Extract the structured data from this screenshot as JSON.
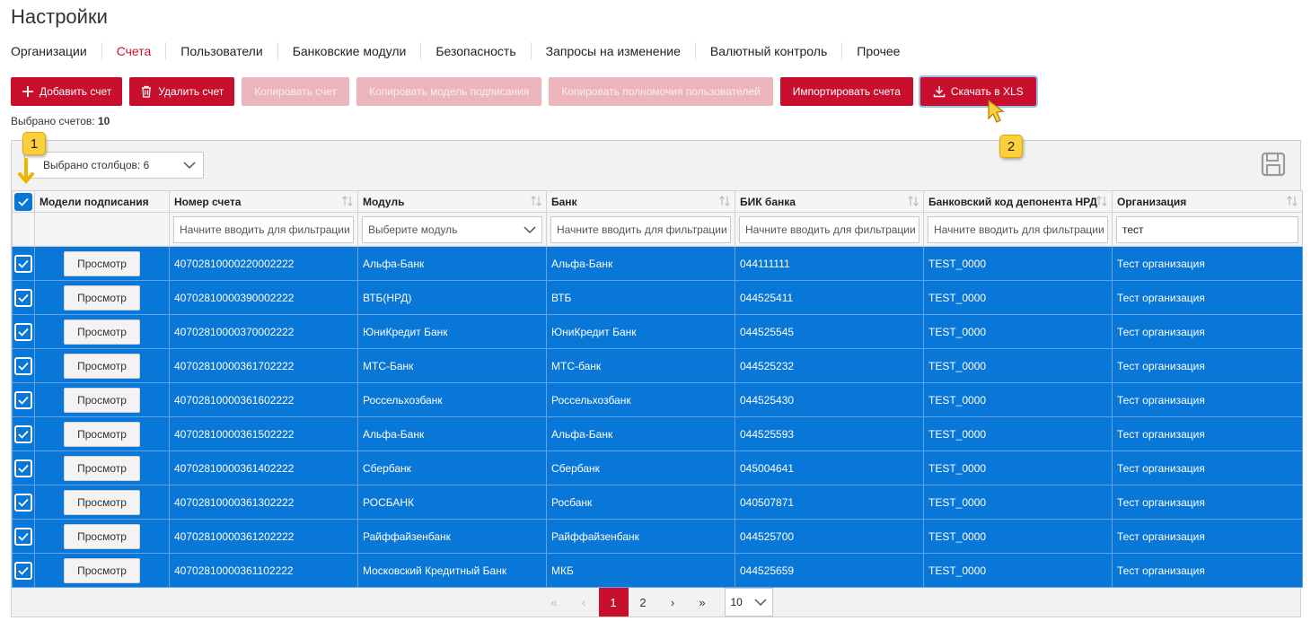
{
  "page": {
    "title": "Настройки"
  },
  "tabs": [
    {
      "label": "Организации",
      "active": false
    },
    {
      "label": "Счета",
      "active": true
    },
    {
      "label": "Пользователи",
      "active": false
    },
    {
      "label": "Банковские модули",
      "active": false
    },
    {
      "label": "Безопасность",
      "active": false
    },
    {
      "label": "Запросы на изменение",
      "active": false
    },
    {
      "label": "Валютный контроль",
      "active": false
    },
    {
      "label": "Прочее",
      "active": false
    }
  ],
  "toolbar": {
    "add_account": "Добавить счет",
    "delete_account": "Удалить счет",
    "copy_account": "Копировать счет",
    "copy_signing_model": "Копировать модель подписания",
    "copy_user_permissions": "Копировать полномочия пользователей",
    "import_accounts": "Импортировать счета",
    "download_xls": "Скачать в XLS"
  },
  "selection": {
    "label": "Выбрано счетов:",
    "count": "10"
  },
  "columns_selector": {
    "label": "Выбрано столбцов: 6"
  },
  "columns": {
    "signing_models": "Модели подписания",
    "account_number": "Номер счета",
    "module": "Модуль",
    "bank": "Банк",
    "bik": "БИК банка",
    "depositary_code": "Банковский код депонента НРД",
    "organization": "Организация"
  },
  "filters": {
    "account_number_placeholder": "Начните вводить для фильтрации",
    "module_placeholder": "Выберите модуль",
    "bank_placeholder": "Начните вводить для фильтрации",
    "bik_placeholder": "Начните вводить для фильтрации",
    "depositary_placeholder": "Начните вводить для фильтрации",
    "organization_value": "тест"
  },
  "view_button_label": "Просмотр",
  "rows": [
    {
      "account": "40702810000220002222",
      "module": "Альфа-Банк",
      "bank": "Альфа-Банк",
      "bik": "044111111",
      "code": "TEST_0000",
      "org": "Тест организация"
    },
    {
      "account": "40702810000390002222",
      "module": "ВТБ(НРД)",
      "bank": "ВТБ",
      "bik": "044525411",
      "code": "TEST_0000",
      "org": "Тест организация"
    },
    {
      "account": "40702810000370002222",
      "module": "ЮниКредит Банк",
      "bank": "ЮниКредит Банк",
      "bik": "044525545",
      "code": "TEST_0000",
      "org": "Тест организация"
    },
    {
      "account": "40702810000361702222",
      "module": "МТС-Банк",
      "bank": "МТС-банк",
      "bik": "044525232",
      "code": "TEST_0000",
      "org": "Тест организация"
    },
    {
      "account": "40702810000361602222",
      "module": "Россельхозбанк",
      "bank": "Россельхозбанк",
      "bik": "044525430",
      "code": "TEST_0000",
      "org": "Тест организация"
    },
    {
      "account": "40702810000361502222",
      "module": "Альфа-Банк",
      "bank": "Альфа-Банк",
      "bik": "044525593",
      "code": "TEST_0000",
      "org": "Тест организация"
    },
    {
      "account": "40702810000361402222",
      "module": "Сбербанк",
      "bank": "Сбербанк",
      "bik": "045004641",
      "code": "TEST_0000",
      "org": "Тест организация"
    },
    {
      "account": "40702810000361302222",
      "module": "РОСБАНК",
      "bank": "Росбанк",
      "bik": "040507871",
      "code": "TEST_0000",
      "org": "Тест организация"
    },
    {
      "account": "40702810000361202222",
      "module": "Райффайзенбанк",
      "bank": "Райффайзенбанк",
      "bik": "044525700",
      "code": "TEST_0000",
      "org": "Тест организация"
    },
    {
      "account": "40702810000361102222",
      "module": "Московский Кредитный Банк",
      "bank": "МКБ",
      "bik": "044525659",
      "code": "TEST_0000",
      "org": "Тест организация"
    }
  ],
  "pagination": {
    "first": "«",
    "prev": "‹",
    "next": "›",
    "last": "»",
    "pages": [
      "1",
      "2"
    ],
    "current": "1",
    "page_size": "10"
  },
  "annotations": {
    "badge1": "1",
    "badge2": "2"
  },
  "colors": {
    "accent": "#c8102e",
    "accent_disabled": "#ecb4bc",
    "selected_row": "#0877d8",
    "badge": "#fcd03a"
  }
}
